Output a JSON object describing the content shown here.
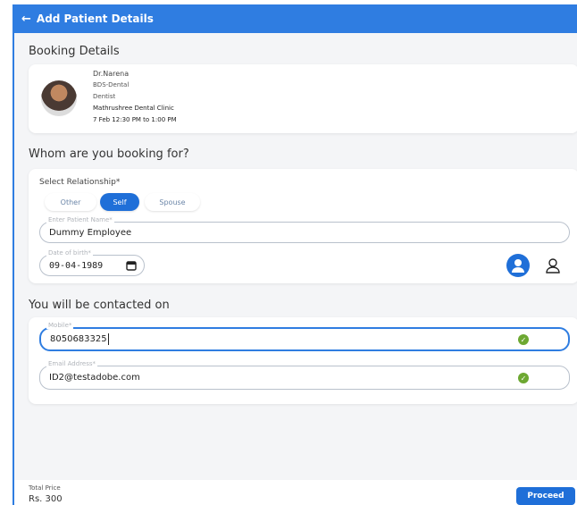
{
  "header": {
    "back_icon": "arrow-left-icon",
    "title": "Add Patient Details"
  },
  "booking": {
    "section_title": "Booking Details",
    "doctor": {
      "name": "Dr.Narena",
      "degree": "BDS-Dental",
      "specialty": "Dentist",
      "clinic": "Mathrushree Dental Clinic",
      "slot": "7 Feb 12:30 PM to 1:00 PM"
    }
  },
  "patient": {
    "section_title": "Whom are you booking for?",
    "relationship_label": "Select Relationship*",
    "relationships": [
      "Other",
      "Self",
      "Spouse"
    ],
    "selected_relationship": "Self",
    "name_label": "Enter Patient Name*",
    "name_value": "Dummy Employee",
    "dob_label": "Date of birth*",
    "dob_value": "09-04-1989",
    "gender_options": [
      "male-avatar-icon",
      "female-avatar-icon"
    ],
    "selected_gender": "male-avatar-icon"
  },
  "contact": {
    "section_title": "You will be contacted on",
    "mobile_label": "Mobile*",
    "mobile_value": "8050683325",
    "email_label": "Email Address*",
    "email_value": "ID2@testadobe.com"
  },
  "footer": {
    "total_label": "Total Price",
    "total_value": "Rs. 300",
    "proceed_label": "Proceed"
  },
  "colors": {
    "primary": "#2f7de1",
    "button": "#1f6fd8",
    "check": "#6da832"
  }
}
